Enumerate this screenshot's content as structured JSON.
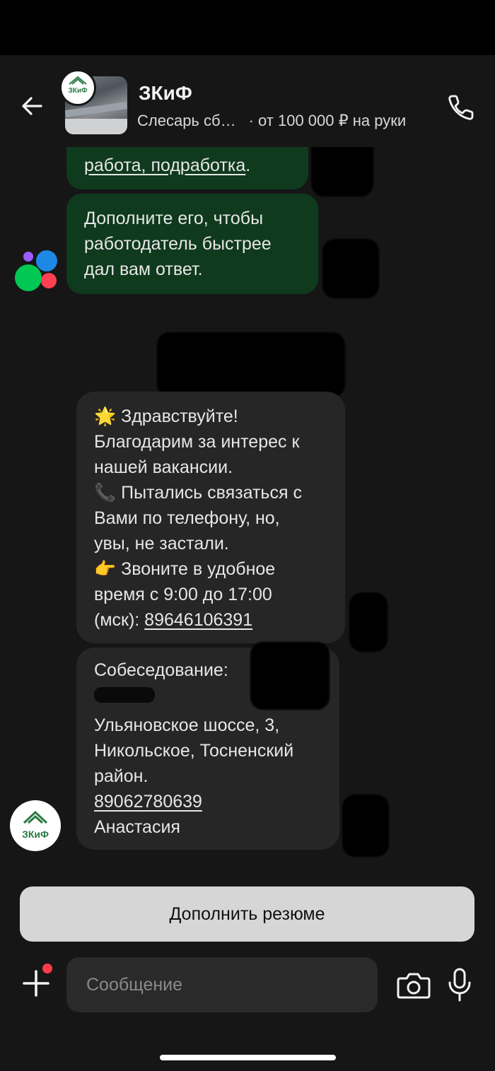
{
  "header": {
    "title": "ЗКиФ",
    "subtitle_job": "Слесарь сб…",
    "subtitle_salary": "· от 100 000 ₽ на руки",
    "logo_text": "ЗКиФ"
  },
  "messages": {
    "system_partial_line": "работа, подработка",
    "system_suffix": ".",
    "system_2_lines": [
      "Дополните его, чтобы",
      "работодатель быстрее",
      "дал вам ответ."
    ],
    "employer_1": {
      "line1_icon": "🌟",
      "line1_text": "Здравствуйте!",
      "line2": "Благодарим за интерес к",
      "line3": "нашей вакансии.",
      "line4_icon": "📞",
      "line4_text": "Пытались связаться с",
      "line5": "Вами по телефону, но,",
      "line6": "увы, не застали.",
      "line7_icon": "👉",
      "line7_text": "Звоните в удобное",
      "line8": "время с 9:00 до 17:00",
      "line9_prefix": "(мск): ",
      "phone": "89646106391"
    },
    "employer_2": {
      "line1": "Собеседование:",
      "line3": "Ульяновское шоссе, 3,",
      "line4": "Никольское, Тосненский",
      "line5": "район.",
      "phone": "89062780639",
      "name": "Анастасия"
    }
  },
  "actions": {
    "resume_button": "Дополнить резюме"
  },
  "composer": {
    "placeholder": "Сообщение"
  },
  "colors": {
    "background": "#161616",
    "system_bubble": "#0f3a1d",
    "employer_bubble": "#262626",
    "notification_dot": "#ff3b4a",
    "brand_green": "#2a7a43"
  }
}
